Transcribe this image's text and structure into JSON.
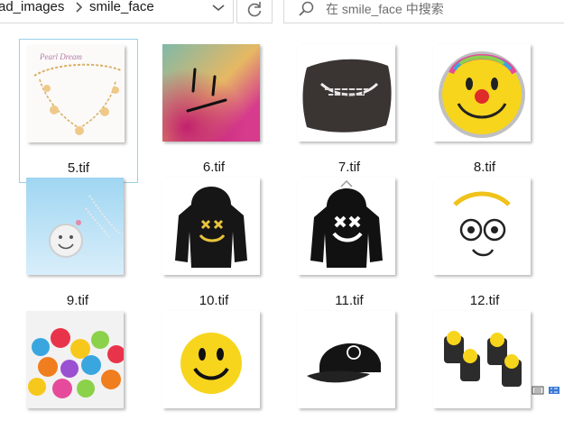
{
  "breadcrumb": {
    "parent": "ad_images",
    "current": "smile_face"
  },
  "search": {
    "placeholder": "在 smile_face 中搜索"
  },
  "icons": {
    "separator": "chevron-right-icon",
    "dropdown": "chevron-down-icon",
    "refresh": "refresh-icon",
    "search": "search-icon"
  },
  "colors": {
    "selection_border": "#99d1ea",
    "field_border": "#d9d9d9"
  },
  "files": [
    {
      "name": "5.tif",
      "selected": true,
      "thumb": "bracelet"
    },
    {
      "name": "6.tif",
      "selected": false,
      "thumb": "gradient-face"
    },
    {
      "name": "7.tif",
      "selected": false,
      "thumb": "pillow"
    },
    {
      "name": "8.tif",
      "selected": false,
      "thumb": "balloon"
    },
    {
      "name": "9.tif",
      "selected": false,
      "thumb": "pendant"
    },
    {
      "name": "10.tif",
      "selected": false,
      "thumb": "hoodie-yellow"
    },
    {
      "name": "11.tif",
      "selected": false,
      "thumb": "hoodie-white"
    },
    {
      "name": "12.tif",
      "selected": false,
      "thumb": "angel-face"
    },
    {
      "name": "",
      "selected": false,
      "thumb": "buttons"
    },
    {
      "name": "",
      "selected": false,
      "thumb": "yellow-ball"
    },
    {
      "name": "",
      "selected": false,
      "thumb": "cap"
    },
    {
      "name": "",
      "selected": false,
      "thumb": "valve-caps"
    }
  ]
}
